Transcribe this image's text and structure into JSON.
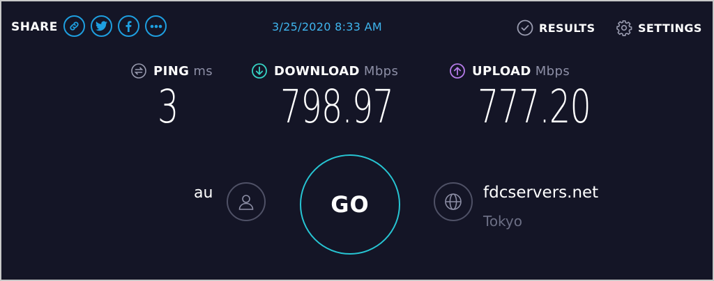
{
  "header": {
    "share_label": "SHARE",
    "share_icons": [
      "link-icon",
      "twitter-icon",
      "facebook-icon",
      "more-icon"
    ],
    "timestamp": "3/25/2020 8:33 AM",
    "results_label": "RESULTS",
    "settings_label": "SETTINGS"
  },
  "metrics": {
    "ping": {
      "label": "PING",
      "unit": "ms",
      "value": "3",
      "icon": "ping-icon"
    },
    "download": {
      "label": "DOWNLOAD",
      "unit": "Mbps",
      "value": "798.97",
      "icon": "download-icon"
    },
    "upload": {
      "label": "UPLOAD",
      "unit": "Mbps",
      "value": "777.20",
      "icon": "upload-icon"
    }
  },
  "connection": {
    "isp": "au",
    "go_label": "GO",
    "server_name": "fdcservers.net",
    "server_location": "Tokyo"
  },
  "colors": {
    "background": "#141526",
    "accent_blue": "#1e9fe0",
    "download_teal": "#36d3c4",
    "upload_purple": "#b57be8",
    "go_ring": "#27c5d3"
  }
}
